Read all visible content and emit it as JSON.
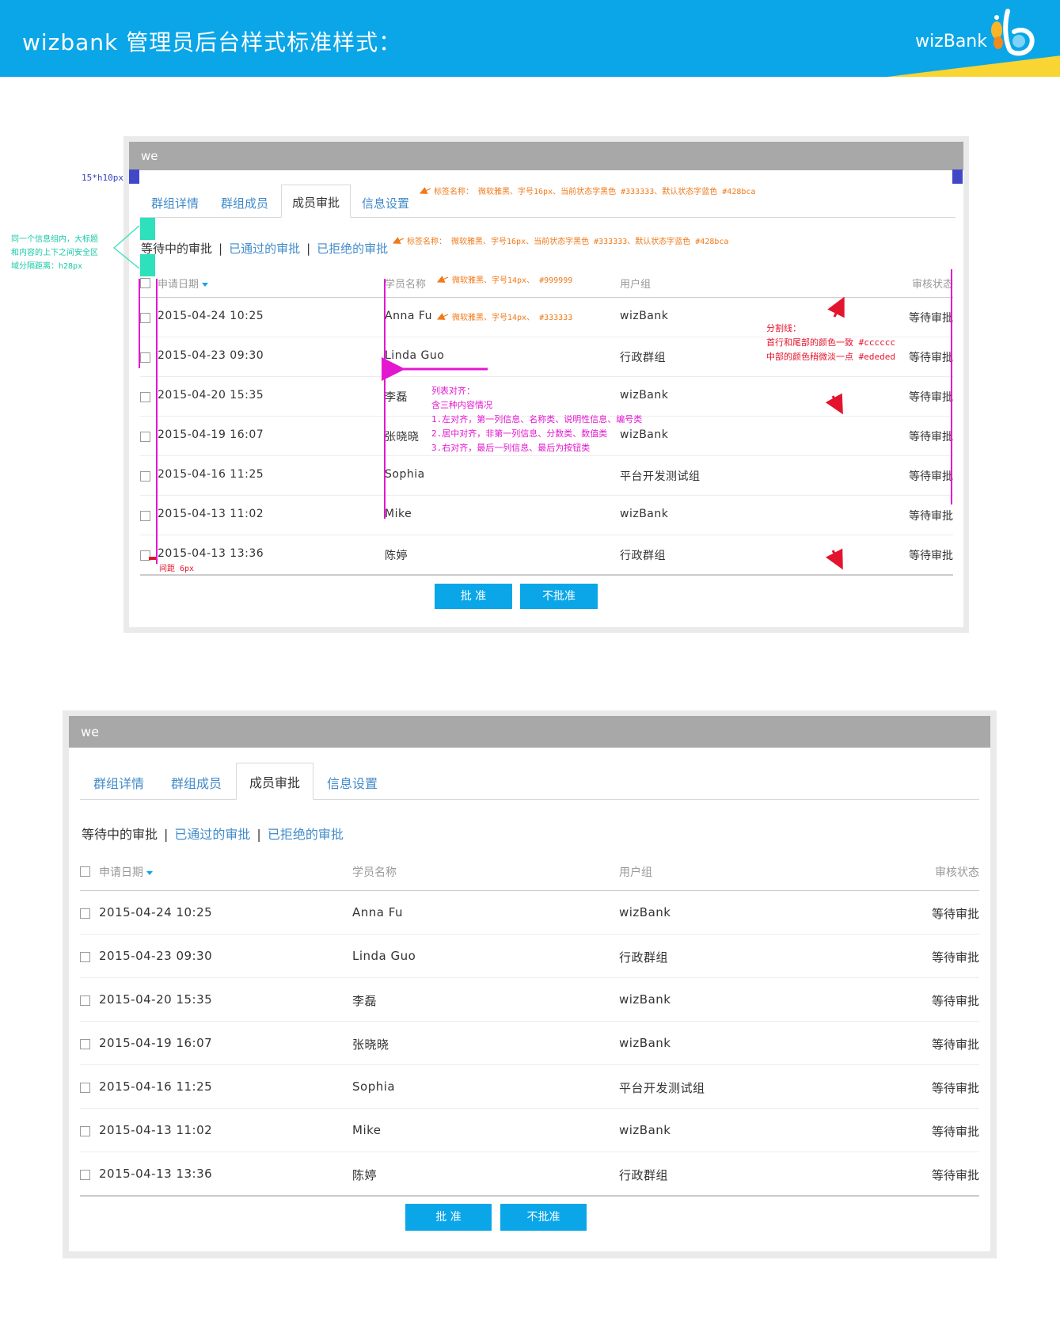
{
  "page": {
    "title": "wizbank 管理员后台样式标准样式：",
    "logo_text": "wizBank"
  },
  "panel": {
    "title": "we",
    "tabs": [
      "群组详情",
      "群组成员",
      "成员审批",
      "信息设置"
    ],
    "active_tab": 2,
    "filters": {
      "current": "等待中的审批",
      "separator": "|",
      "links": [
        "已通过的审批",
        "已拒绝的审批"
      ]
    },
    "columns": [
      "申请日期",
      "学员名称",
      "用户组",
      "审核状态"
    ],
    "rows": [
      {
        "date": "2015-04-24  10:25",
        "name": "Anna Fu",
        "group": "wizBank",
        "status": "等待审批"
      },
      {
        "date": "2015-04-23  09:30",
        "name": "Linda Guo",
        "group": "行政群组",
        "status": "等待审批"
      },
      {
        "date": "2015-04-20  15:35",
        "name": "李磊",
        "group": "wizBank",
        "status": "等待审批"
      },
      {
        "date": "2015-04-19  16:07",
        "name": "张晓晓",
        "group": "wizBank",
        "status": "等待审批"
      },
      {
        "date": "2015-04-16  11:25",
        "name": "Sophia",
        "group": "平台开发测试组",
        "status": "等待审批"
      },
      {
        "date": "2015-04-13  11:02",
        "name": "Mike",
        "group": "wizBank",
        "status": "等待审批"
      },
      {
        "date": "2015-04-13  13:36",
        "name": "陈婷",
        "group": "行政群组",
        "status": "等待审批"
      }
    ],
    "buttons": {
      "approve": "批 准",
      "reject": "不批准"
    }
  },
  "annotations": {
    "size_note": "15*h10px",
    "tab_note": "标签名称： 微软雅黑、字号16px、当前状态字黑色 #333333、默认状态字蓝色 #428bca",
    "filter_note": "标签名称： 微软雅黑、字号16px、当前状态字黑色 #333333、默认状态字蓝色 #428bca",
    "spacing_note": "同一个信息组内，大标题和内容的上下之间安全区域分隔距离：h28px",
    "header_note": "微软雅黑、字号14px、 #999999",
    "cell_note": "微软雅黑、字号14px、 #333333",
    "divider_note": [
      "分割线：",
      "首行和尾部的颜色一致 #cccccc",
      "中部的颜色稍微淡一点 #ededed"
    ],
    "align_note": [
      "列表对齐：",
      "含三种内容情况",
      "1.左对齐，第一列信息、名称类、说明性信息、编号类",
      "2.居中对齐，非第一列信息、分数类、数值类",
      "3.右对齐，最后一列信息、最后为按钮类"
    ],
    "gap_note": "间距 6px"
  },
  "colors": {
    "banner": "#0aa6e8",
    "accent_yellow": "#f9d534",
    "link_blue": "#428bca",
    "text_dark": "#333333",
    "header_gray": "#999999",
    "panel_head": "#a8a8a8",
    "divider_edge": "#cccccc",
    "divider_mid": "#ededed",
    "button": "#0aa6e8"
  }
}
